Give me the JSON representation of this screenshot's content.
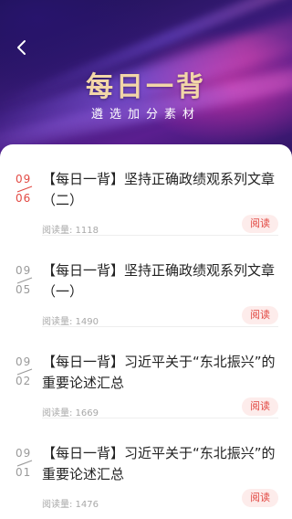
{
  "header": {
    "title": "每日一背",
    "subtitle": "遴选加分素材",
    "back_icon": "chevron-left-icon"
  },
  "colors": {
    "active_date": "#e24a44",
    "inactive_date": "#9a9a9a",
    "button_text": "#e24a44",
    "button_bg": "#fdeceb",
    "hero_title": "#f2d6a8"
  },
  "articles": [
    {
      "month": "09",
      "day": "06",
      "title": "【每日一背】坚持正确政绩观系列文章（二）",
      "reads_label": "阅读量: 1118",
      "action_label": "阅读",
      "active": true
    },
    {
      "month": "09",
      "day": "05",
      "title": "【每日一背】坚持正确政绩观系列文章（一）",
      "reads_label": "阅读量: 1490",
      "action_label": "阅读",
      "active": false
    },
    {
      "month": "09",
      "day": "02",
      "title": "【每日一背】习近平关于“东北振兴”的重要论述汇总",
      "reads_label": "阅读量: 1669",
      "action_label": "阅读",
      "active": false
    },
    {
      "month": "09",
      "day": "01",
      "title": "【每日一背】习近平关于“东北振兴”的重要论述汇总",
      "reads_label": "阅读量: 1476",
      "action_label": "阅读",
      "active": false
    }
  ]
}
